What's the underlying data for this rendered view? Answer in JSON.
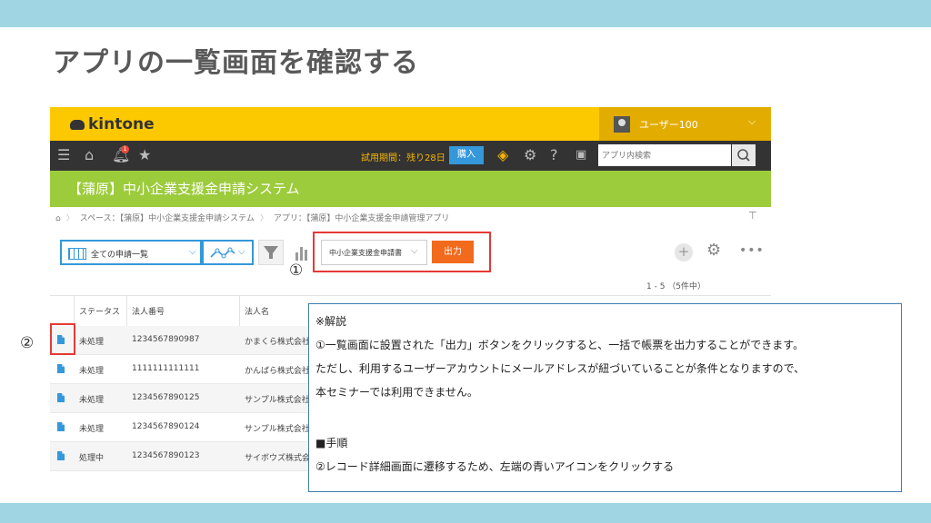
{
  "slide": {
    "title": "アプリの一覧画面を確認する",
    "marker1": "①",
    "marker2": "②"
  },
  "header": {
    "logo": "kintone",
    "user_name": "ユーザー100",
    "brand_color": "#fcc800"
  },
  "navbar": {
    "trial_text": "試用期間：残り28日",
    "buy_label": "購入",
    "search_placeholder": "アプリ内検索",
    "notification_count": "1"
  },
  "app": {
    "title": "【蒲原】中小企業支援金申請システム"
  },
  "breadcrumb": {
    "space": "スペース：【蒲原】中小企業支援金申請システム",
    "app": "アプリ：【蒲原】中小企業支援金申請管理アプリ"
  },
  "toolbar": {
    "view_label": "全ての申請一覧",
    "print_template": "中小企業支援金申請書",
    "output_label": "出力",
    "output_color": "#f26a1b"
  },
  "list": {
    "count": "1 - 5 （5件中）",
    "columns": [
      "ステータス",
      "法人番号",
      "法人名"
    ],
    "rows": [
      {
        "status": "未処理",
        "number": "1234567890987",
        "name": "かまくら株式会社"
      },
      {
        "status": "未処理",
        "number": "1111111111111",
        "name": "かんばら株式会社"
      },
      {
        "status": "未処理",
        "number": "1234567890125",
        "name": "サンプル株式会社"
      },
      {
        "status": "未処理",
        "number": "1234567890124",
        "name": "サンプル株式会社"
      },
      {
        "status": "処理中",
        "number": "1234567890123",
        "name": "サイボウズ株式会社"
      }
    ]
  },
  "explanation": {
    "heading": "※解説",
    "line1": "①一覧画面に設置された「出力」ボタンをクリックすると、一括で帳票を出力することができます。",
    "line2": "ただし、利用するユーザーアカウントにメールアドレスが紐づいていることが条件となりますので、",
    "line3": "本セミナーでは利用できません。",
    "steps_heading": "■手順",
    "step1": "②レコード詳細画面に遷移するため、左端の青いアイコンをクリックする"
  }
}
